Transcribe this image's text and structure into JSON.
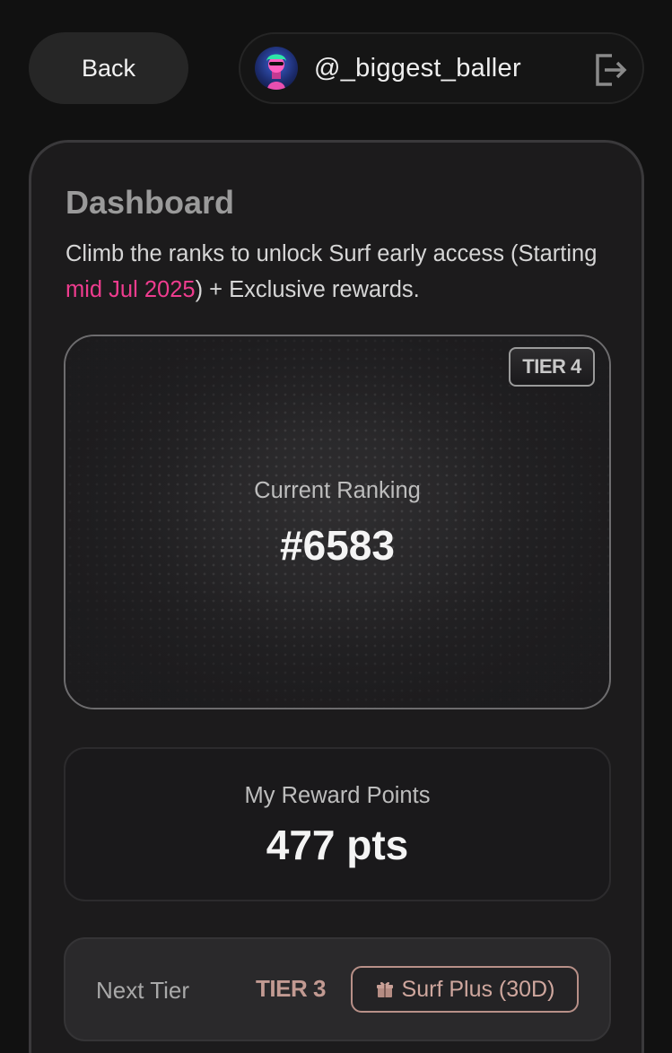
{
  "topbar": {
    "back_label": "Back",
    "username": "@_biggest_baller"
  },
  "dashboard": {
    "title": "Dashboard",
    "subtitle_prefix": "Climb the ranks to unlock Surf early access (Starting ",
    "subtitle_highlight": "mid Jul 2025",
    "subtitle_suffix": ") + Exclusive rewards.",
    "highlight_color": "#ee3c8e"
  },
  "ranking": {
    "tier_badge": "TIER 4",
    "label": "Current Ranking",
    "value": "#6583"
  },
  "points": {
    "label": "My Reward Points",
    "value": "477 pts"
  },
  "next_tier": {
    "label": "Next Tier",
    "tier": "TIER 3",
    "reward": "Surf Plus (30D)",
    "reward_icon": "gift-icon"
  },
  "icons": {
    "logout": "logout-icon",
    "avatar": "avatar"
  }
}
